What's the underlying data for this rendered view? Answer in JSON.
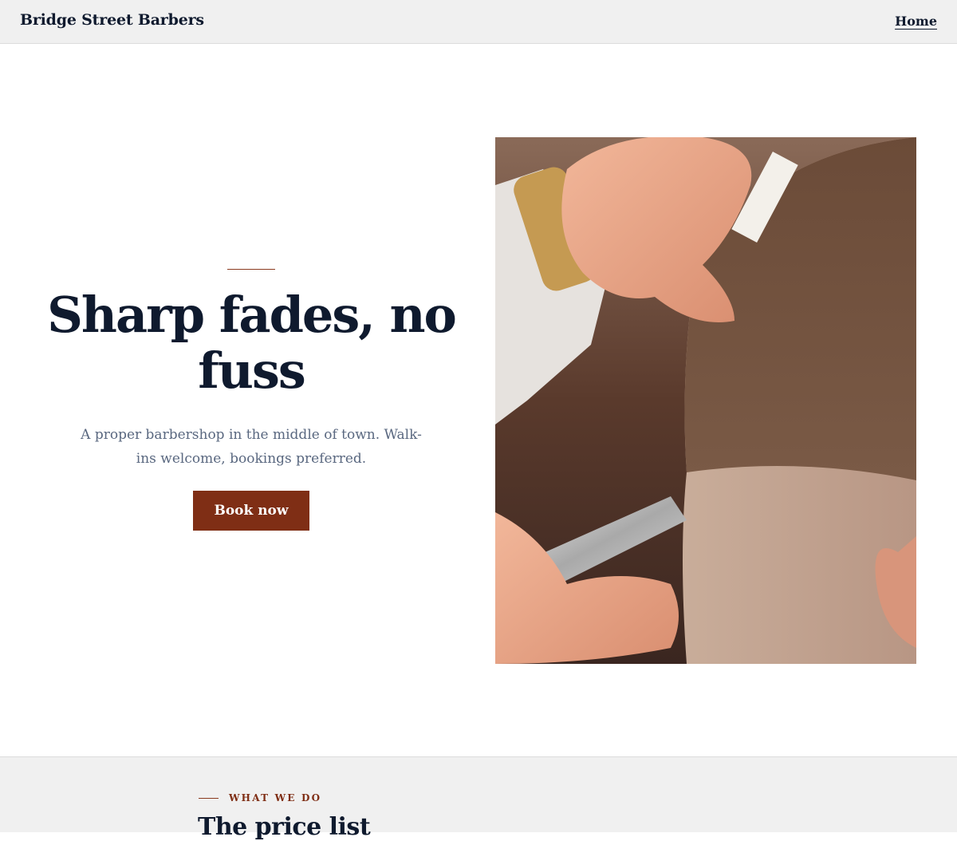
{
  "header": {
    "brand": "Bridge Street Barbers",
    "nav_home": "Home"
  },
  "hero": {
    "title": "Sharp fades, no fuss",
    "subtitle": "A proper barbershop in the middle of town. Walk-ins welcome, bookings preferred.",
    "cta_label": "Book now",
    "image_icon": "barber-cutting-hair-photo"
  },
  "services": {
    "eyebrow": "WHAT WE DO",
    "title": "The price list"
  },
  "colors": {
    "accent": "#7f2e15",
    "text_dark": "#0f1a2e",
    "text_muted": "#5a6880",
    "header_bg": "#f0f0f0"
  }
}
